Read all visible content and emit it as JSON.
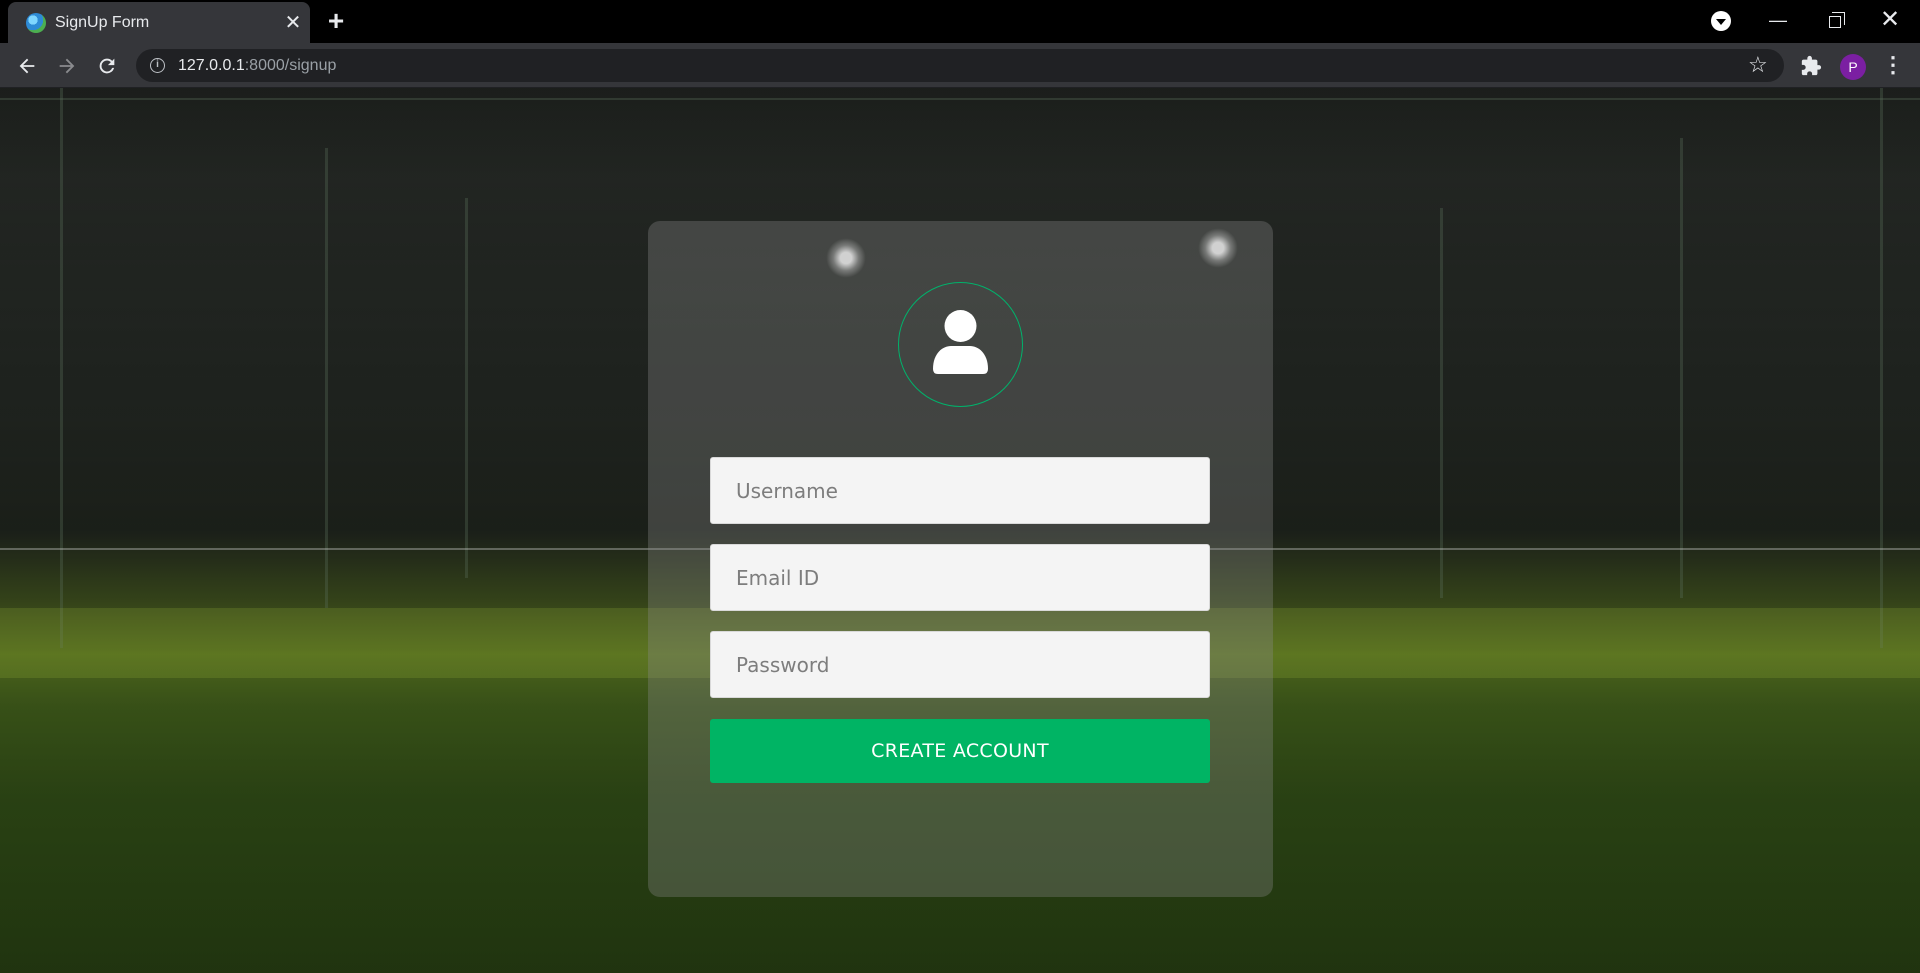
{
  "browser": {
    "tab_title": "SignUp Form",
    "tab_close": "✕",
    "new_tab": "+",
    "url_host": "127.0.0.1",
    "url_path": ":8000/signup",
    "profile_initial": "P",
    "window_controls": {
      "minimize": "—",
      "close": "✕"
    },
    "icons": [
      "back-arrow-icon",
      "forward-arrow-icon",
      "reload-icon",
      "info-icon",
      "star-icon",
      "extensions-icon",
      "kebab-menu-icon"
    ]
  },
  "signup_form": {
    "username_placeholder": "Username",
    "email_placeholder": "Email ID",
    "password_placeholder": "Password",
    "submit_label": "CREATE ACCOUNT",
    "accent_color": "#00b464",
    "avatar_icon": "user-icon"
  }
}
